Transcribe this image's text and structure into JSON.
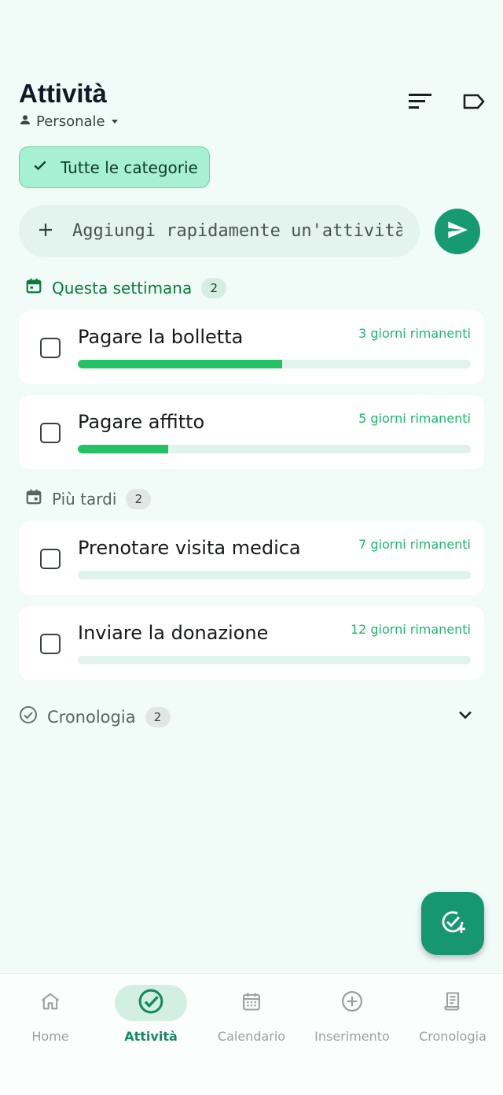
{
  "header": {
    "title": "Attività",
    "profile": "Personale",
    "sort_icon": "sort-icon",
    "label_icon": "label-icon"
  },
  "filter_chip": {
    "label": "Tutte le categorie",
    "icon": "check-icon"
  },
  "quick_add": {
    "placeholder": "Aggiungi rapidamente un'attività..."
  },
  "sections": {
    "this_week": {
      "title": "Questa settimana",
      "count": "2",
      "tasks": [
        {
          "title": "Pagare la bolletta",
          "remaining": "3 giorni rimanenti",
          "progress": 0.52
        },
        {
          "title": "Pagare affitto",
          "remaining": "5 giorni rimanenti",
          "progress": 0.23
        }
      ]
    },
    "later": {
      "title": "Più tardi",
      "count": "2",
      "tasks": [
        {
          "title": "Prenotare visita medica",
          "remaining": "7 giorni rimanenti",
          "progress": 0
        },
        {
          "title": "Inviare la donazione",
          "remaining": "12 giorni rimanenti",
          "progress": 0
        }
      ]
    },
    "history": {
      "title": "Cronologia",
      "count": "2"
    }
  },
  "bottom_nav": [
    {
      "label": "Home",
      "icon": "home-icon",
      "active": false
    },
    {
      "label": "Attività",
      "icon": "check-circle-icon",
      "active": true
    },
    {
      "label": "Calendario",
      "icon": "calendar-icon",
      "active": false
    },
    {
      "label": "Inserimento",
      "icon": "plus-circle-icon",
      "active": false
    },
    {
      "label": "Cronologia",
      "icon": "receipt-icon",
      "active": false
    }
  ],
  "colors": {
    "background": "#f1fbf7",
    "accent": "#159a72",
    "progress": "#25c165",
    "remaining_text": "#1fb86a"
  }
}
